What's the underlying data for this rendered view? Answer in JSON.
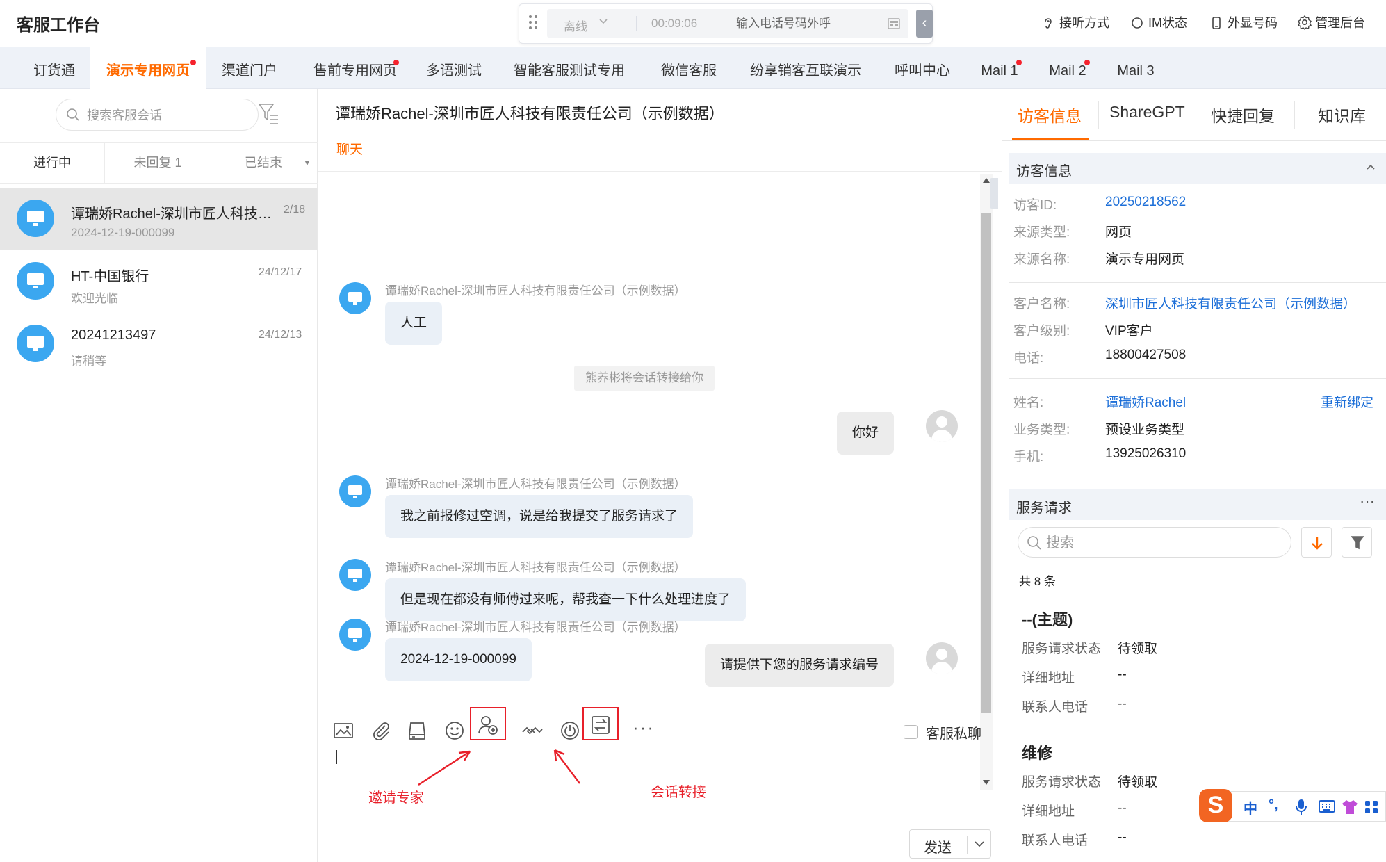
{
  "header": {
    "app_title": "客服工作台",
    "status": "离线",
    "timer": "00:09:06",
    "phone_placeholder": "输入电话号码外呼",
    "links": {
      "listen_mode": "接听方式",
      "im_status": "IM状态",
      "display_number": "外显号码",
      "admin": "管理后台"
    }
  },
  "tabs": [
    {
      "label": "订货通",
      "dot": false
    },
    {
      "label": "演示专用网页",
      "dot": true,
      "active": true
    },
    {
      "label": "渠道门户",
      "dot": false
    },
    {
      "label": "售前专用网页",
      "dot": true
    },
    {
      "label": "多语测试",
      "dot": false
    },
    {
      "label": "智能客服测试专用",
      "dot": false
    },
    {
      "label": "微信客服",
      "dot": false
    },
    {
      "label": "纷享销客互联演示",
      "dot": false
    },
    {
      "label": "呼叫中心",
      "dot": false
    },
    {
      "label": "Mail 1",
      "dot": true
    },
    {
      "label": "Mail 2",
      "dot": true
    },
    {
      "label": "Mail 3",
      "dot": false
    }
  ],
  "left": {
    "search_placeholder": "搜索客服会话",
    "status_tabs": [
      "进行中",
      "未回复 1",
      "已结束"
    ],
    "conversations": [
      {
        "name": "谭瑞娇Rachel-深圳市匠人科技有限责任公司（示例数据）",
        "date": "2/18",
        "sub": "2024-12-19-000099"
      },
      {
        "name": "HT-中国银行",
        "date": "24/12/17",
        "sub": "欢迎光临"
      },
      {
        "name": "20241213497",
        "date": "24/12/13",
        "sub": "请稍等"
      }
    ]
  },
  "chat": {
    "title": "谭瑞娇Rachel-深圳市匠人科技有限责任公司（示例数据）",
    "subtab": "聊天",
    "customer_name": "谭瑞娇Rachel-深圳市匠人科技有限责任公司（示例数据）",
    "messages": {
      "m1": "人工",
      "system": "熊养彬将会话转接给你",
      "a1": "你好",
      "m2": "我之前报修过空调，说是给我提交了服务请求了",
      "m3": "但是现在都没有师傅过来呢，帮我查一下什么处理进度了",
      "a2": "请提供下您的服务请求编号",
      "m4": "2024-12-19-000099"
    },
    "private_chat_label": "客服私聊",
    "send_label": "发送",
    "annotations": {
      "invite_expert": "邀请专家",
      "transfer": "会话转接"
    }
  },
  "right": {
    "tabs": [
      "访客信息",
      "ShareGPT",
      "快捷回复",
      "知识库"
    ],
    "visitor_section": "访客信息",
    "visitor": {
      "id_label": "访客ID:",
      "id_value": "20250218562",
      "source_type_label": "来源类型:",
      "source_type_value": "网页",
      "source_name_label": "来源名称:",
      "source_name_value": "演示专用网页",
      "customer_label": "客户名称:",
      "customer_value": "深圳市匠人科技有限责任公司（示例数据）",
      "level_label": "客户级别:",
      "level_value": "VIP客户",
      "phone_label": "电话:",
      "phone_value": "18800427508",
      "name_label": "姓名:",
      "name_value": "谭瑞娇Rachel",
      "rebind": "重新绑定",
      "biz_label": "业务类型:",
      "biz_value": "预设业务类型",
      "mobile_label": "手机:",
      "mobile_value": "13925026310"
    },
    "service_section": "服务请求",
    "more": "···",
    "search_placeholder": "搜索",
    "total": "共 8 条",
    "requests": [
      {
        "heading": "--(主题)",
        "status_label": "服务请求状态",
        "status": "待领取",
        "address_label": "详细地址",
        "address": "--",
        "contact_label": "联系人电话",
        "contact": "--"
      },
      {
        "heading": "维修",
        "status_label": "服务请求状态",
        "status": "待领取",
        "address_label": "详细地址",
        "address": "--",
        "contact_label": "联系人电话",
        "contact": "--"
      }
    ]
  },
  "ime": {
    "logo": "S",
    "lang": "中",
    "punct": "°,"
  },
  "colors": {
    "accent": "#ff6a00",
    "link": "#1d6fd8",
    "annotation": "#e8202a",
    "avatar": "#3ba7f0"
  }
}
